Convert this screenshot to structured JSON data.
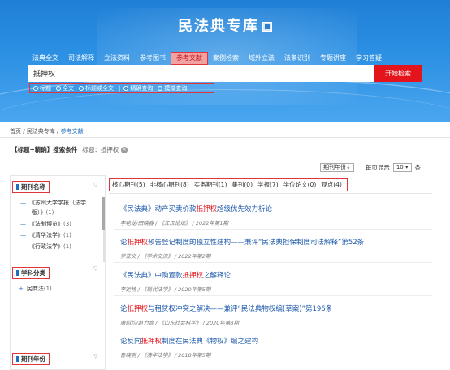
{
  "header": {
    "site_title": "民法典专库",
    "nav": [
      "法典全文",
      "司法解释",
      "立法资料",
      "参考图书",
      "参考文献",
      "案例检索",
      "域外立法",
      "法条识别",
      "专题讲座",
      "学习答疑"
    ],
    "active_nav_index": 4,
    "search_value": "抵押权",
    "search_button": "开始检索",
    "options": {
      "scope": [
        "标题",
        "全文",
        "标题或全文"
      ],
      "scope_selected": 0,
      "mode": [
        "精确查询",
        "模糊查询"
      ],
      "mode_selected": 0
    }
  },
  "breadcrumb": {
    "home": "首页",
    "sep": " / ",
    "level1": "民法典专库",
    "level2": "参考文献"
  },
  "conditions": {
    "label": "【标题+精确】搜索条件",
    "tag": "标题：抵押权",
    "clear": "×"
  },
  "controls": {
    "sort_value": "期刊年份↓",
    "per_page_label": "每页显示",
    "per_page_value": "10",
    "unit": "条"
  },
  "sidebar": {
    "sections": [
      {
        "title": "期刊名称",
        "items": [
          {
            "text": "《苏州大学学报（法学",
            "text2": "版）》",
            "count": "(1)"
          },
          {
            "text": "《法制博览》",
            "count": "(3)"
          },
          {
            "text": "《清华法学》",
            "count": "(1)"
          },
          {
            "text": "《行政法学》",
            "count": "(1)"
          }
        ]
      },
      {
        "title": "学科分类",
        "items": [
          {
            "prefix": "+",
            "text": "民商法",
            "count": "(1)"
          }
        ]
      },
      {
        "title": "期刊年份",
        "items": []
      }
    ]
  },
  "tabs": [
    {
      "label": "核心期刊",
      "count": "(5)"
    },
    {
      "label": "非核心期刊",
      "count": "(8)"
    },
    {
      "label": "实务期刊",
      "count": "(1)"
    },
    {
      "label": "集刊",
      "count": "(0)"
    },
    {
      "label": "学报",
      "count": "(7)"
    },
    {
      "label": "学位论文",
      "count": "(0)"
    },
    {
      "label": "观点",
      "count": "(4)"
    }
  ],
  "results": [
    {
      "pre": "《民法典》动产买卖价款",
      "hl": "抵押权",
      "post": "超级优先效力析论",
      "meta": "李艳龙/田晓春 / 《江汉论坛》 / 2022年第1期"
    },
    {
      "pre": "论",
      "hl": "抵押权",
      "post": "预告登记制度的独立性建构——兼评“民法典担保制度司法解释”第52条",
      "meta": "罗亚文 / 《学术交流》 / 2022年第2期"
    },
    {
      "pre": "《民法典》中购置款",
      "hl": "抵押权",
      "post": "之解释论",
      "meta": "李运杨 / 《现代法学》 / 2020年第5期"
    },
    {
      "pre": "论",
      "hl": "抵押权",
      "post": "与租赁权冲突之解决——兼评“民法典物权编(草案)”第196条",
      "meta": "唐绍均/赵力青 / 《山东社会科学》 / 2020年第8期"
    },
    {
      "pre": "论反向",
      "hl": "抵押权",
      "post": "制度在民法典《物权》编之建构",
      "meta": "鲁晓明 / 《清华法学》 / 2018年第5期"
    }
  ]
}
